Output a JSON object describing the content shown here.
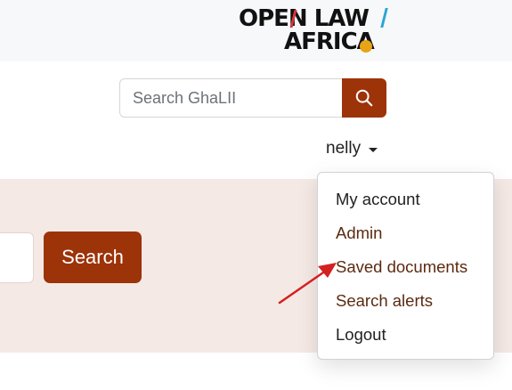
{
  "header": {
    "logo": {
      "line1": "OPEN LAW",
      "line2": "AFRICA"
    }
  },
  "search": {
    "placeholder": "Search GhaLII",
    "button_icon": "search-icon"
  },
  "user_menu": {
    "username": "nelly",
    "items": [
      {
        "label": "My account"
      },
      {
        "label": "Admin"
      },
      {
        "label": "Saved documents"
      },
      {
        "label": "Search alerts"
      },
      {
        "label": "Logout"
      }
    ]
  },
  "hero": {
    "search_button_label": "Search"
  },
  "colors": {
    "brand": "#9c3309",
    "hero_background": "#f5e9e5",
    "annotation_arrow": "#d42020"
  }
}
